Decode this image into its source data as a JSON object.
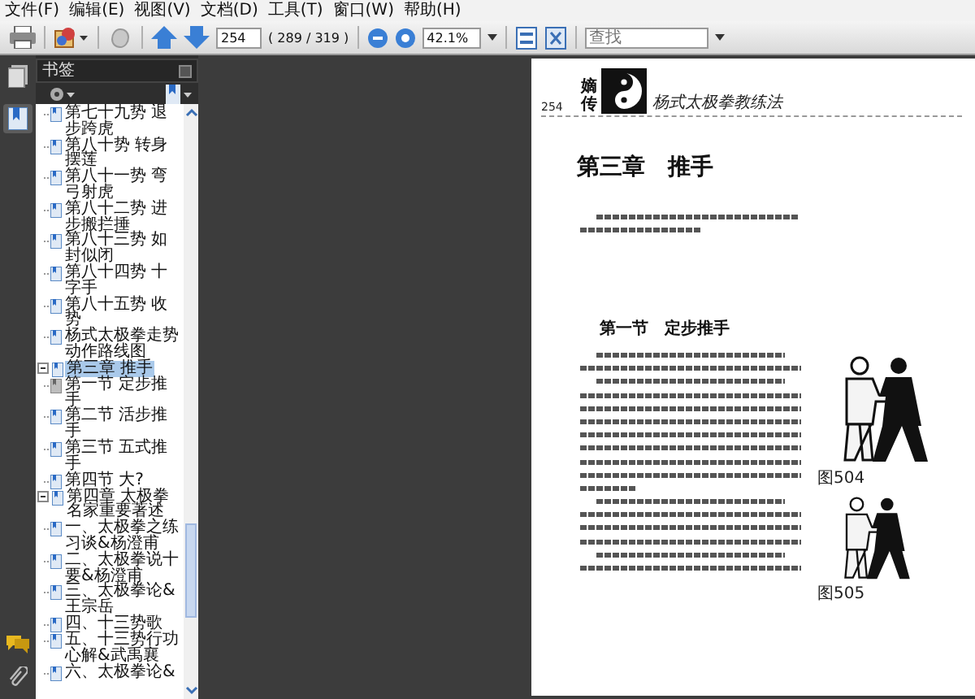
{
  "menu": [
    "文件(F)",
    "编辑(E)",
    "视图(V)",
    "文档(D)",
    "工具(T)",
    "窗口(W)",
    "帮助(H)"
  ],
  "toolbar": {
    "page": "254",
    "page_count": "( 289 / 319 )",
    "zoom": "42.1%",
    "search_placeholder": "查找"
  },
  "side_tabs": [
    {
      "kind": "pages",
      "selected": false
    },
    {
      "kind": "bookmarks",
      "selected": true
    }
  ],
  "sidebar": {
    "title": "书签",
    "continued": [
      {
        "label": "第七十九势 退步跨虎",
        "selected": false,
        "current": false
      },
      {
        "label": "第八十势 转身摆莲",
        "selected": false,
        "current": false
      },
      {
        "label": "第八十一势 弯弓射虎",
        "selected": false,
        "current": false
      },
      {
        "label": "第八十二势 进步搬拦捶",
        "selected": false,
        "current": false
      },
      {
        "label": "第八十三势 如封似闭",
        "selected": false,
        "current": false
      },
      {
        "label": "第八十四势 十字手",
        "selected": false,
        "current": false
      },
      {
        "label": "第八十五势 收势",
        "selected": false,
        "current": false
      },
      {
        "label": "杨式太极拳走势动作路线图",
        "selected": false,
        "current": false
      }
    ],
    "bookmarks": [
      {
        "label": "第三章 推手",
        "selected": true,
        "expanded": true,
        "current": false,
        "children": [
          {
            "label": "第一节 定步推手",
            "selected": false,
            "current": true
          },
          {
            "label": "第二节 活步推手",
            "selected": false,
            "current": false
          },
          {
            "label": "第三节 五式推手",
            "selected": false,
            "current": false
          },
          {
            "label": "第四节 大?",
            "selected": false,
            "current": false
          }
        ]
      },
      {
        "label": "第四章 太极拳名家重要著述",
        "selected": false,
        "expanded": true,
        "current": false,
        "children": [
          {
            "label": "一、太极拳之练习谈&杨澄甫",
            "selected": false,
            "current": false
          },
          {
            "label": "二、太极拳说十要&杨澄甫",
            "selected": false,
            "current": false
          },
          {
            "label": "三、太极拳论&王宗岳",
            "selected": false,
            "current": false
          },
          {
            "label": "四、十三势歌",
            "selected": false,
            "current": false
          },
          {
            "label": "五、十三势行功心解&武禹襄",
            "selected": false,
            "current": false
          },
          {
            "label": "六、太极拳论&",
            "selected": false,
            "current": false
          }
        ]
      }
    ]
  },
  "page": {
    "number": "254",
    "logo_text": "嫡传",
    "running_title": "杨式太极拳教练法",
    "chapter_title": "第三章　推手",
    "section_title": "第一节　定步推手",
    "figures": [
      {
        "caption": "图504"
      },
      {
        "caption": "图505"
      }
    ]
  }
}
